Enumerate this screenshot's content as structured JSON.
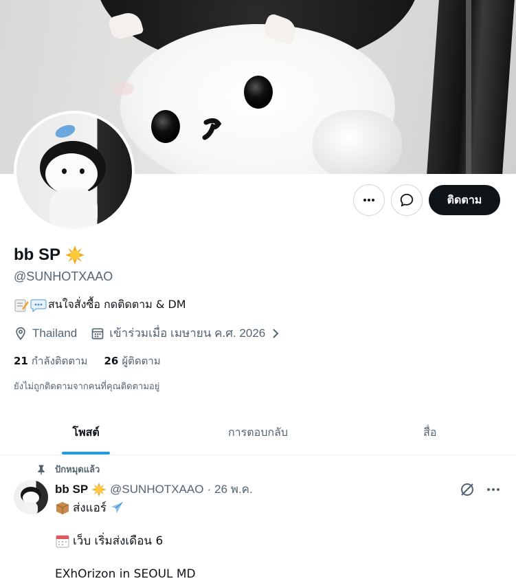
{
  "profile": {
    "display_name": "bb SP",
    "handle": "@SUNHOTXAAO",
    "bio": "สนใจสั่งซื้อ กดติดตาม & DM",
    "location": "Thailand",
    "joined": "เข้าร่วมเมื่อ เมษายน ค.ศ. 2026",
    "following_count": "21",
    "following_label": "กำลังติดตาม",
    "followers_count": "26",
    "followers_label": "ผู้ติดตาม",
    "followed_by_note": "ยังไม่ถูกติดตามจากคนที่คุณติดตามอยู่"
  },
  "actions": {
    "follow_label": "ติดตาม"
  },
  "tabs": [
    {
      "label": "โพสต์",
      "active": true
    },
    {
      "label": "การตอบกลับ",
      "active": false
    },
    {
      "label": "สื่อ",
      "active": false
    }
  ],
  "post": {
    "pinned_label": "ปักหมุดแล้ว",
    "name": "bb SP",
    "handle": "@SUNHOTXAAO",
    "separator": "·",
    "date": "26 พ.ค.",
    "lines": [
      "ส่งแอร์",
      "เว็บ เริ่มส่งเดือน 6",
      "EXhOrizon in SEOUL MD"
    ]
  },
  "icons": {
    "verified_badge": "sun-emoji-icon",
    "bio_emoji_1": "memo-icon",
    "bio_emoji_2": "speech-bubble-icon",
    "location": "location-pin-icon",
    "calendar": "calendar-icon",
    "more": "more-icon",
    "message": "message-icon",
    "pin": "pin-icon",
    "grok": "grok-icon"
  },
  "colors": {
    "text_primary": "#0f1419",
    "text_secondary": "#536471",
    "accent": "#1d9bf0",
    "follow_bg": "#0f1419",
    "border": "#cfd9de"
  }
}
